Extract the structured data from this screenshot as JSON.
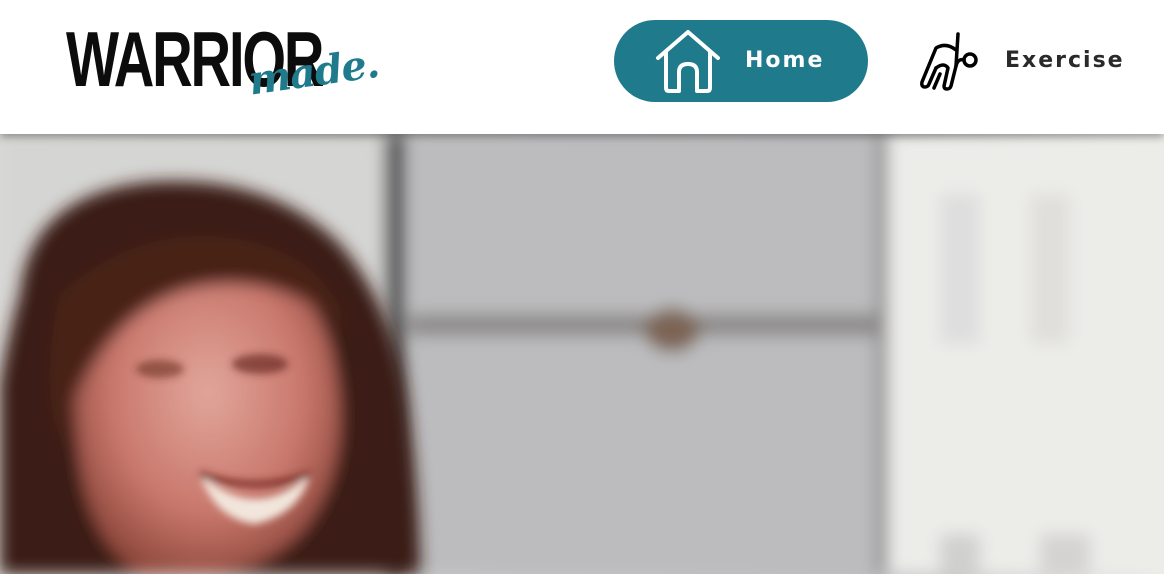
{
  "brand": {
    "logo_main": "WARRIOR",
    "logo_script": "made.",
    "colors": {
      "accent": "#1f7a8c",
      "text": "#0c0c0c"
    }
  },
  "nav": {
    "items": [
      {
        "label": "Home",
        "icon": "house-icon",
        "active": true
      },
      {
        "label": "Exercise",
        "icon": "exercise-figure-icon",
        "active": false
      }
    ]
  },
  "hero": {
    "image": "blurred-photo-smiling-woman"
  }
}
